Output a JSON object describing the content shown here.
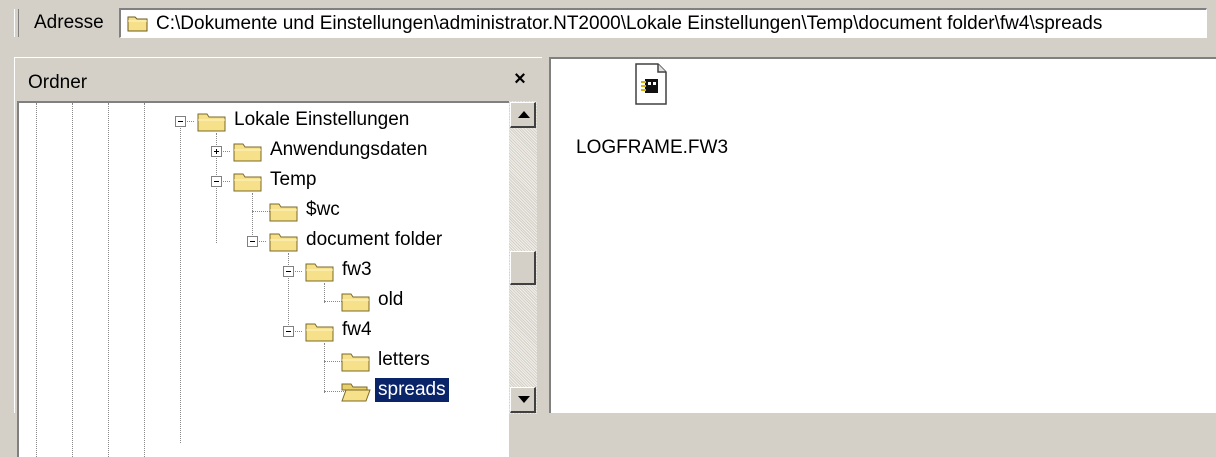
{
  "address_bar": {
    "label": "Adresse",
    "path": "C:\\Dokumente und Einstellungen\\administrator.NT2000\\Lokale Einstellungen\\Temp\\document folder\\fw4\\spreads"
  },
  "folder_pane": {
    "title": "Ordner",
    "close_glyph": "×",
    "tree": {
      "lokale_einstellungen": "Lokale Einstellungen",
      "anwendungsdaten": "Anwendungsdaten",
      "temp": "Temp",
      "wc": "$wc",
      "document_folder": "document folder",
      "fw3": "fw3",
      "old": "old",
      "fw4": "fw4",
      "letters": "letters",
      "spreads": "spreads"
    },
    "selected": "spreads"
  },
  "file_pane": {
    "files": [
      {
        "name": "LOGFRAME.FW3",
        "icon": "application-document-icon"
      }
    ]
  },
  "colors": {
    "window_face": "#d4d0c8",
    "selection": "#0a246a",
    "folder_yellow": "#f7e08a"
  }
}
